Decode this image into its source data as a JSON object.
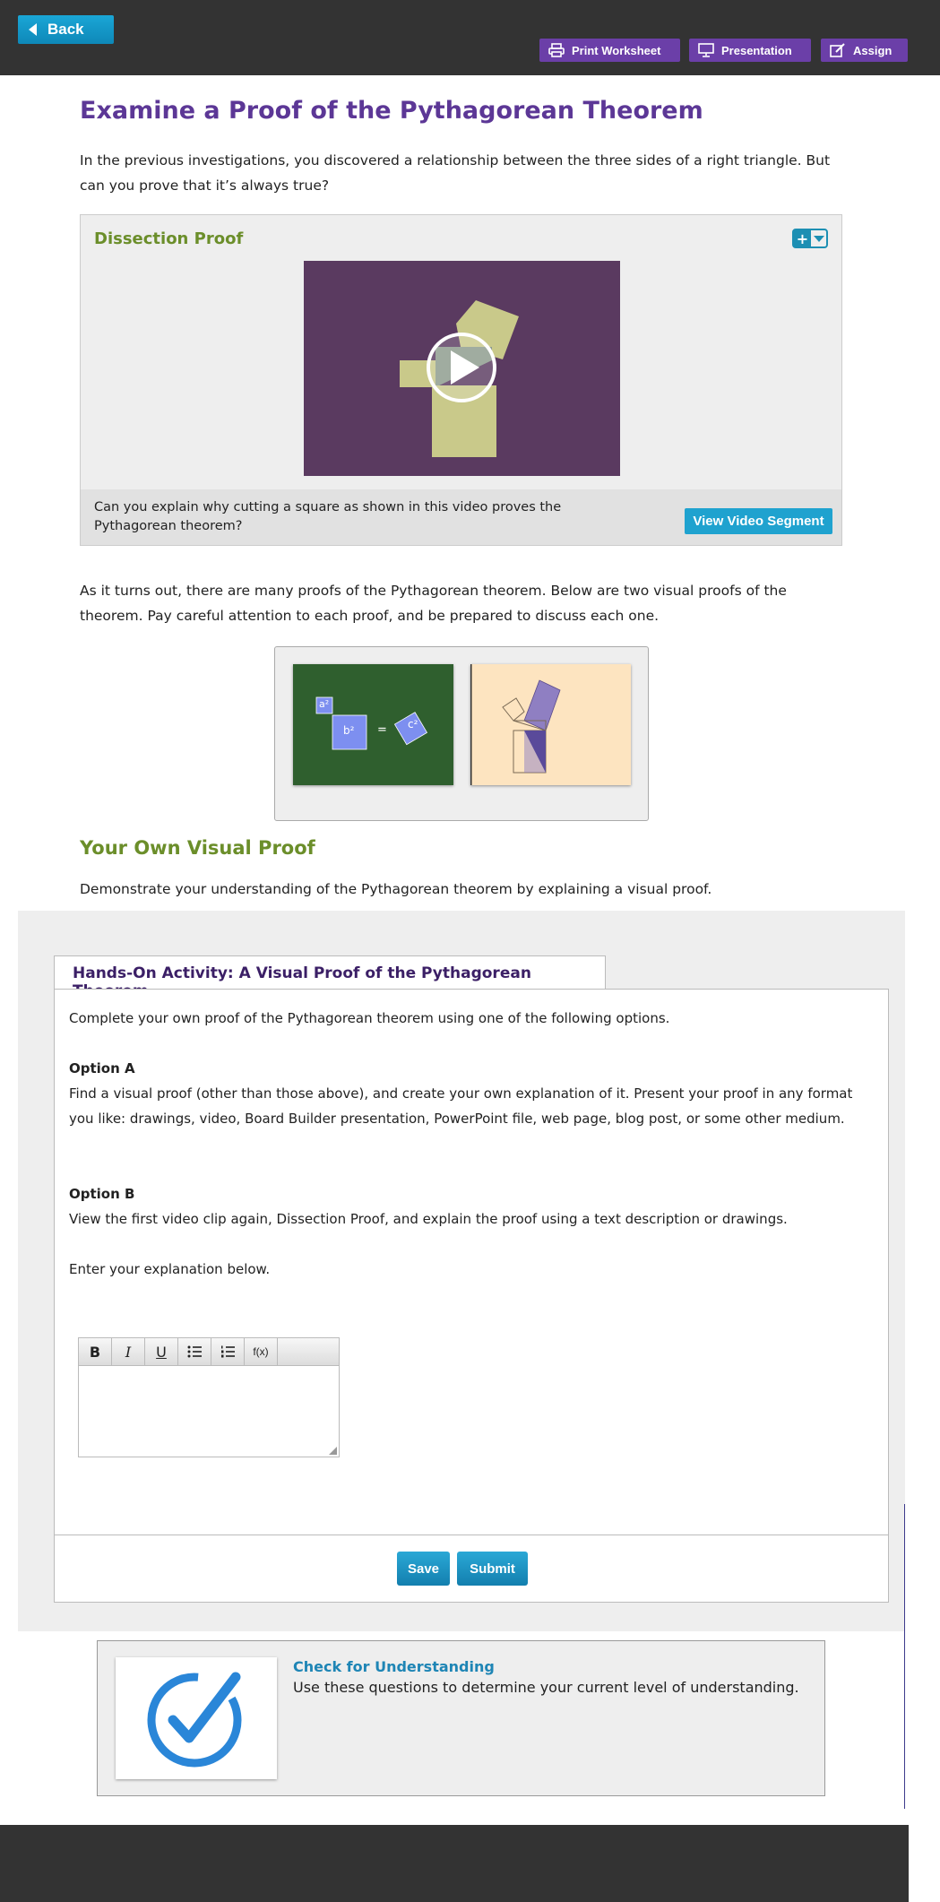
{
  "topbar": {
    "back_label": "Back",
    "print_label": "Print Worksheet",
    "presentation_label": "Presentation",
    "assign_label": "Assign"
  },
  "page": {
    "title": "Examine a Proof of the Pythagorean Theorem",
    "intro": "In the previous investigations, you discovered a relationship between the three sides of a right triangle. But can you prove that it’s always true?",
    "proofs_text": "As it turns out, there are many proofs of the Pythagorean theorem. Below are two visual proofs of the theorem. Pay careful attention to each proof, and be prepared to discuss each one."
  },
  "video": {
    "title": "Dissection Proof",
    "question": "Can you explain why cutting a square as shown in this video proves the Pythagorean theorem?",
    "button_label": "View Video Segment"
  },
  "gallery": {
    "thumb1": {
      "a": "a²",
      "b": "b²",
      "eq": "=",
      "c": "c²"
    }
  },
  "own_proof": {
    "heading": "Your Own Visual Proof",
    "text": "Demonstrate your understanding of the Pythagorean theorem by explaining a visual proof."
  },
  "activity": {
    "tab_label": "Hands-On Activity: A Visual Proof of the Pythagorean Theorem",
    "intro": "Complete your own proof of the Pythagorean theorem using one of the following options.",
    "option_a_title": "Option A",
    "option_a_text": "Find a visual proof (other than those above), and create your own explanation of it. Present your proof in any format you like: drawings, video, Board Builder presentation, PowerPoint file, web page, blog post, or some other medium.",
    "option_b_title": "Option B",
    "option_b_text": "View the first video clip again, Dissection Proof, and explain the proof using a text description or drawings.",
    "enter_text": "Enter your explanation below.",
    "editor_buttons": [
      "B",
      "I",
      "U",
      "bullet-list",
      "numbered-list",
      "f(x)"
    ],
    "formula_label": "f(x)",
    "save_label": "Save",
    "submit_label": "Submit"
  },
  "check": {
    "title": "Check for Understanding",
    "description": "Use these questions to determine your current level of understanding."
  },
  "colors": {
    "topbar": "#333333",
    "title_purple": "#5c3796",
    "heading_green": "#6b8e2a",
    "accent_blue": "#1fa2cf",
    "purple_button": "#6b3fa8"
  }
}
